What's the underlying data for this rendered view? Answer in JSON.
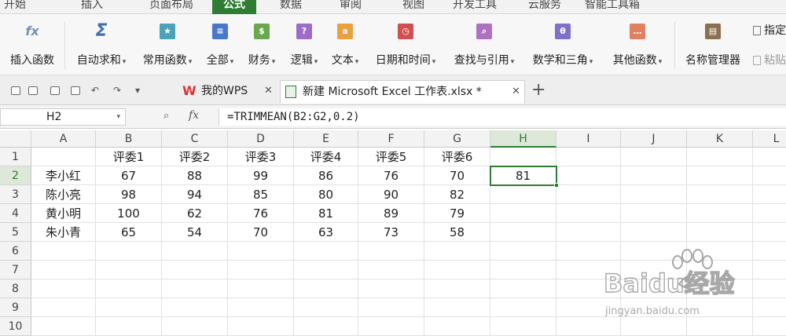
{
  "menu": {
    "tabs": [
      "开始",
      "插入",
      "页面布局",
      "公式",
      "数据",
      "审阅",
      "视图",
      "开发工具",
      "云服务",
      "智能工具箱"
    ],
    "active_tab": "公式"
  },
  "ribbon": {
    "buttons": [
      {
        "label": "插入函数",
        "icon": "fx-icon",
        "caret": false,
        "color": "#7a8fb0"
      },
      {
        "label": "自动求和",
        "icon": "sigma-icon",
        "caret": true,
        "color": "#3b6fb0"
      },
      {
        "label": "常用函数",
        "icon": "star-book-icon",
        "caret": true,
        "color": "#4aa3b8"
      },
      {
        "label": "全部",
        "icon": "list-book-icon",
        "caret": true,
        "color": "#4a78c8"
      },
      {
        "label": "财务",
        "icon": "finance-book-icon",
        "caret": true,
        "color": "#6aa84f"
      },
      {
        "label": "逻辑",
        "icon": "question-book-icon",
        "caret": true,
        "color": "#9c6cc8"
      },
      {
        "label": "文本",
        "icon": "text-book-icon",
        "caret": true,
        "color": "#e8a040"
      },
      {
        "label": "日期和时间",
        "icon": "clock-book-icon",
        "caret": true,
        "color": "#d05050"
      },
      {
        "label": "查找与引用",
        "icon": "search-book-icon",
        "caret": true,
        "color": "#b070c0"
      },
      {
        "label": "数学和三角",
        "icon": "theta-book-icon",
        "caret": true,
        "color": "#8070c8"
      },
      {
        "label": "其他函数",
        "icon": "more-book-icon",
        "caret": true,
        "color": "#e08060"
      },
      {
        "label": "名称管理器",
        "icon": "name-manager-icon",
        "caret": false,
        "color": "#8a7050"
      }
    ],
    "side_items": [
      "指定",
      "粘贴"
    ]
  },
  "quickbar": {
    "icons": [
      "save-icon",
      "save-as-icon",
      "print-icon",
      "print-preview-icon",
      "undo-icon",
      "redo-icon",
      "more-icon"
    ]
  },
  "doc_tabs": [
    {
      "label": "我的WPS",
      "icon": "wps-logo-icon"
    },
    {
      "label": "新建 Microsoft Excel 工作表.xlsx *",
      "icon": "excel-file-icon"
    }
  ],
  "formula_bar": {
    "name_box": "H2",
    "fx_label": "fx",
    "formula": "=TRIMMEAN(B2:G2,0.2)"
  },
  "sheet": {
    "columns": [
      "A",
      "B",
      "C",
      "D",
      "E",
      "F",
      "G",
      "H",
      "I",
      "J",
      "K",
      "L"
    ],
    "rows": [
      "1",
      "2",
      "3",
      "4",
      "5",
      "6",
      "7",
      "8",
      "9",
      "10"
    ],
    "selected_column": "H",
    "selected_row": "2",
    "cells": [
      [
        "",
        "评委1",
        "评委2",
        "评委3",
        "评委4",
        "评委5",
        "评委6",
        ""
      ],
      [
        "李小红",
        "67",
        "88",
        "99",
        "86",
        "76",
        "70",
        "81"
      ],
      [
        "陈小亮",
        "98",
        "94",
        "85",
        "80",
        "90",
        "82",
        ""
      ],
      [
        "黄小明",
        "100",
        "62",
        "76",
        "81",
        "89",
        "79",
        ""
      ],
      [
        "朱小青",
        "65",
        "54",
        "70",
        "63",
        "73",
        "58",
        ""
      ]
    ]
  },
  "watermark": {
    "brand": "Baidu经验",
    "url": "jingyan.baidu.com"
  },
  "colors": {
    "accent": "#2e7d32"
  }
}
